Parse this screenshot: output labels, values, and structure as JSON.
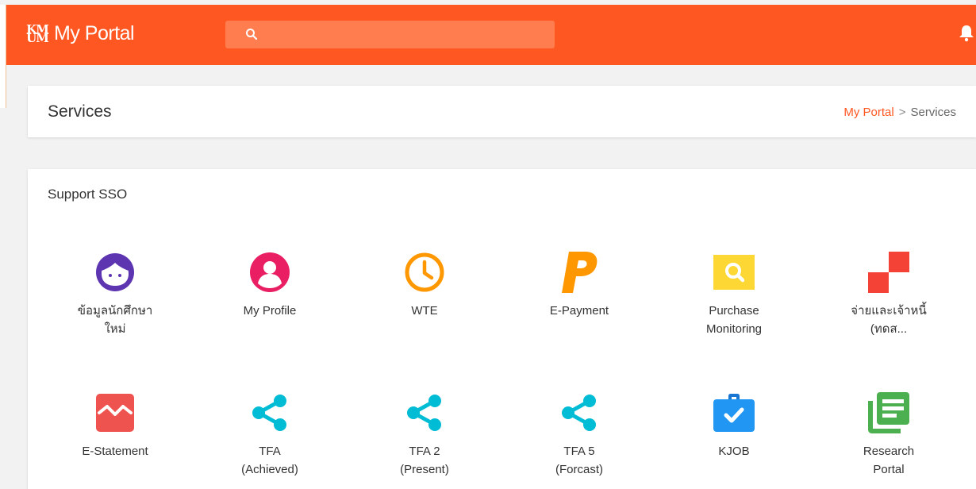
{
  "app": {
    "logo_text": "KM UM",
    "brand": "My Portal"
  },
  "search": {
    "placeholder": "",
    "icon": "search-icon"
  },
  "header": {
    "title": "Services",
    "breadcrumb": [
      "My Portal",
      "Services"
    ]
  },
  "section": {
    "title": "Support SSO"
  },
  "colors": {
    "primary": "#ff5722",
    "search_bg": "#ff7d4f"
  },
  "services": [
    {
      "icon": "student-face-icon",
      "line1": "ข้อมูลนักศึกษา",
      "line2": "ใหม่"
    },
    {
      "icon": "profile-icon",
      "line1": "My Profile",
      "line2": ""
    },
    {
      "icon": "clock-icon",
      "line1": "WTE",
      "line2": ""
    },
    {
      "icon": "payment-p-icon",
      "line1": "E-Payment",
      "line2": ""
    },
    {
      "icon": "magnifier-icon",
      "line1": "Purchase",
      "line2": "Monitoring"
    },
    {
      "icon": "red-blocks-icon",
      "line1": "จ่ายและเจ้าหนี้",
      "line2": "(ทดส..."
    },
    {
      "icon": "statement-chart-icon",
      "line1": "E-Statement",
      "line2": ""
    },
    {
      "icon": "share-icon",
      "line1": "TFA",
      "line2": "(Achieved)"
    },
    {
      "icon": "share-icon",
      "line1": "TFA 2",
      "line2": "(Present)"
    },
    {
      "icon": "share-icon",
      "line1": "TFA 5",
      "line2": "(Forcast)"
    },
    {
      "icon": "briefcase-check-icon",
      "line1": "KJOB",
      "line2": ""
    },
    {
      "icon": "document-list-icon",
      "line1": "Research",
      "line2": "Portal"
    }
  ]
}
